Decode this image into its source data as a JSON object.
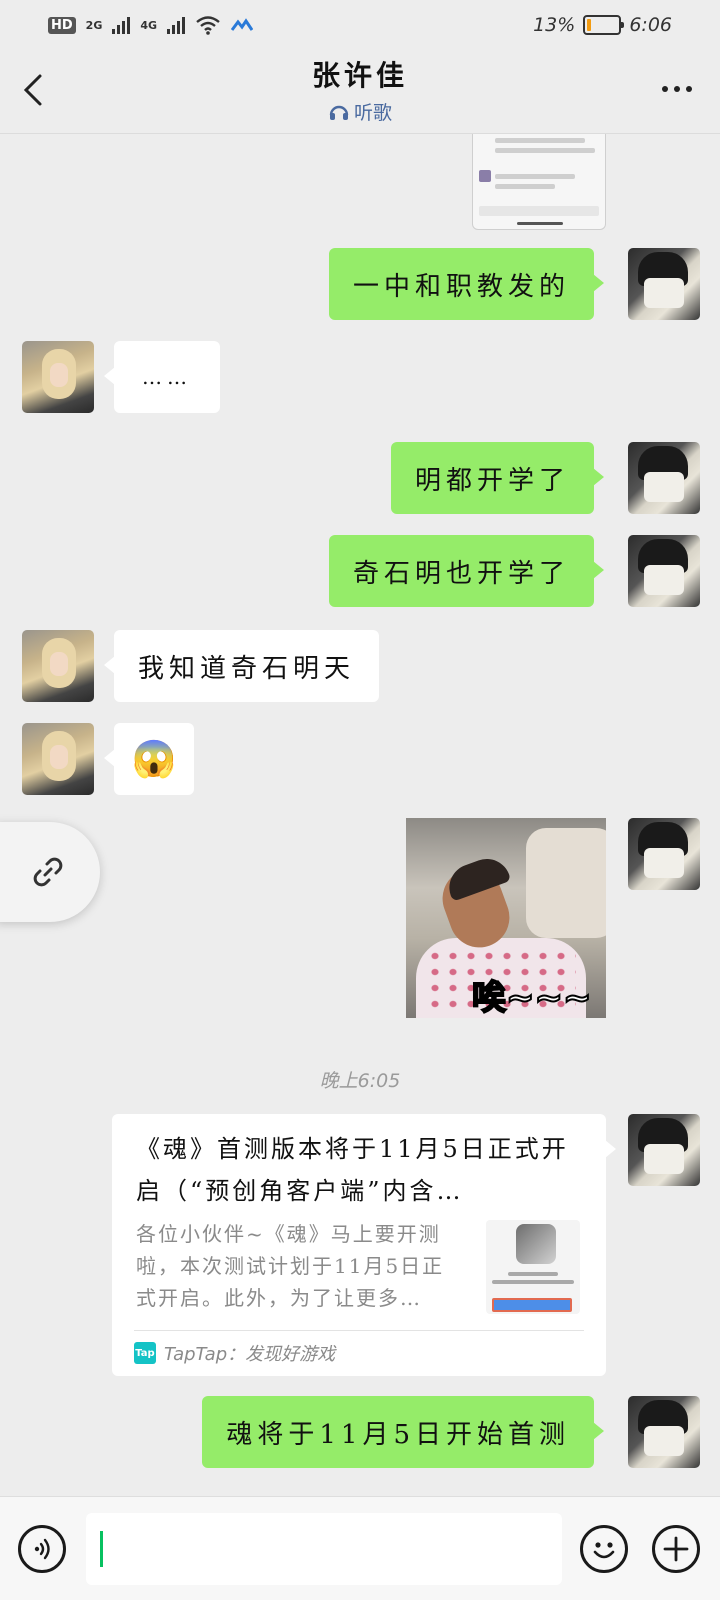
{
  "status_bar": {
    "hd": "HD",
    "sim_2g": "2G",
    "sim_4g": "4G",
    "battery_percent": "13%",
    "time": "6:06",
    "battery_level": 0.13,
    "battery_color": "#f39c12"
  },
  "header": {
    "title": "张许佳",
    "subtitle": "听歌",
    "subtitle_color": "#4a6aa0"
  },
  "messages": [
    {
      "from": "me",
      "type": "image",
      "desc": "shared screenshot"
    },
    {
      "from": "me",
      "type": "text",
      "text": "一中和职教发的"
    },
    {
      "from": "her",
      "type": "text",
      "text": "……"
    },
    {
      "from": "me",
      "type": "text",
      "text": "明都开学了"
    },
    {
      "from": "me",
      "type": "text",
      "text": "奇石明也开学了"
    },
    {
      "from": "her",
      "type": "text",
      "text": "我知道奇石明天"
    },
    {
      "from": "her",
      "type": "emoji",
      "text": "😱"
    },
    {
      "from": "me",
      "type": "sticker",
      "text": "唉~~~"
    },
    {
      "from": "me",
      "type": "text",
      "text": "魂将于11月5日开始首测"
    }
  ],
  "timestamp": "晚上6:05",
  "link_card": {
    "title": "《魂》首测版本将于11月5日正式开启（“预创角客户端”内含…",
    "description": "各位小伙伴~《魂》马上要开测啦，本次测试计划于11月5日正式开启。此外，为了让更多…",
    "source": "TapTap：发现好游戏",
    "source_logo": "Tap"
  },
  "colors": {
    "my_bubble": "#95ec69",
    "her_bubble": "#ffffff",
    "background": "#ededed",
    "caret": "#07c160"
  },
  "icons": {
    "back": "chevron-left-icon",
    "more": "more-dots-icon",
    "link": "link-icon",
    "voice": "voice-icon",
    "emoji": "emoji-icon",
    "plus": "plus-icon"
  }
}
